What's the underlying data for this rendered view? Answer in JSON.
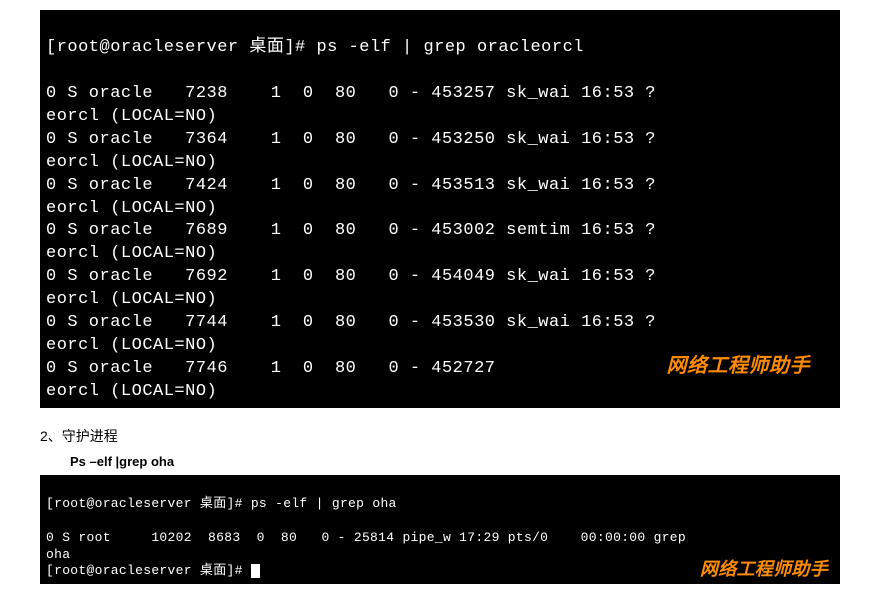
{
  "terminal1": {
    "prompt": "[root@oracleserver 桌面]# ",
    "command": "ps -elf | grep oracleorcl",
    "rows": [
      {
        "f": "0",
        "s": "S",
        "user": "oracle",
        "pid": "7238",
        "ppid": "1",
        "c": "0",
        "pri": "80",
        "ni": "0",
        "dash": "-",
        "sz": "453257",
        "wchan": "sk_wai",
        "time": "16:53",
        "tty": "?",
        "cmd": "eorcl (LOCAL=NO)"
      },
      {
        "f": "0",
        "s": "S",
        "user": "oracle",
        "pid": "7364",
        "ppid": "1",
        "c": "0",
        "pri": "80",
        "ni": "0",
        "dash": "-",
        "sz": "453250",
        "wchan": "sk_wai",
        "time": "16:53",
        "tty": "?",
        "cmd": "eorcl (LOCAL=NO)"
      },
      {
        "f": "0",
        "s": "S",
        "user": "oracle",
        "pid": "7424",
        "ppid": "1",
        "c": "0",
        "pri": "80",
        "ni": "0",
        "dash": "-",
        "sz": "453513",
        "wchan": "sk_wai",
        "time": "16:53",
        "tty": "?",
        "cmd": "eorcl (LOCAL=NO)"
      },
      {
        "f": "0",
        "s": "S",
        "user": "oracle",
        "pid": "7689",
        "ppid": "1",
        "c": "0",
        "pri": "80",
        "ni": "0",
        "dash": "-",
        "sz": "453002",
        "wchan": "semtim",
        "time": "16:53",
        "tty": "?",
        "cmd": "eorcl (LOCAL=NO)"
      },
      {
        "f": "0",
        "s": "S",
        "user": "oracle",
        "pid": "7692",
        "ppid": "1",
        "c": "0",
        "pri": "80",
        "ni": "0",
        "dash": "-",
        "sz": "454049",
        "wchan": "sk_wai",
        "time": "16:53",
        "tty": "?",
        "cmd": "eorcl (LOCAL=NO)"
      },
      {
        "f": "0",
        "s": "S",
        "user": "oracle",
        "pid": "7744",
        "ppid": "1",
        "c": "0",
        "pri": "80",
        "ni": "0",
        "dash": "-",
        "sz": "453530",
        "wchan": "sk_wai",
        "time": "16:53",
        "tty": "?",
        "cmd": "eorcl (LOCAL=NO)"
      },
      {
        "f": "0",
        "s": "S",
        "user": "oracle",
        "pid": "7746",
        "ppid": "1",
        "c": "0",
        "pri": "80",
        "ni": "0",
        "dash": "-",
        "sz": "452727",
        "wchan": "",
        "time": "",
        "tty": "",
        "cmd": "eorcl (LOCAL=NO)"
      }
    ],
    "watermark": "网络工程师助手"
  },
  "section2": {
    "label": "2、守护进程",
    "cmd_label": "Ps –elf |grep oha"
  },
  "terminal2": {
    "prompt1": "[root@oracleserver 桌面]# ",
    "command1": "ps -elf | grep oha",
    "row": {
      "f": "0",
      "s": "S",
      "user": "root",
      "pid": "10202",
      "ppid": "8683",
      "c": "0",
      "pri": "80",
      "ni": "0",
      "dash": "-",
      "sz": "25814",
      "wchan": "pipe_w",
      "time": "17:29",
      "tty": "pts/0",
      "dur": "00:00:00",
      "cmd1": "grep",
      "cmd2": "oha"
    },
    "prompt2": "[root@oracleserver 桌面]# ",
    "watermark": "网络工程师助手"
  }
}
